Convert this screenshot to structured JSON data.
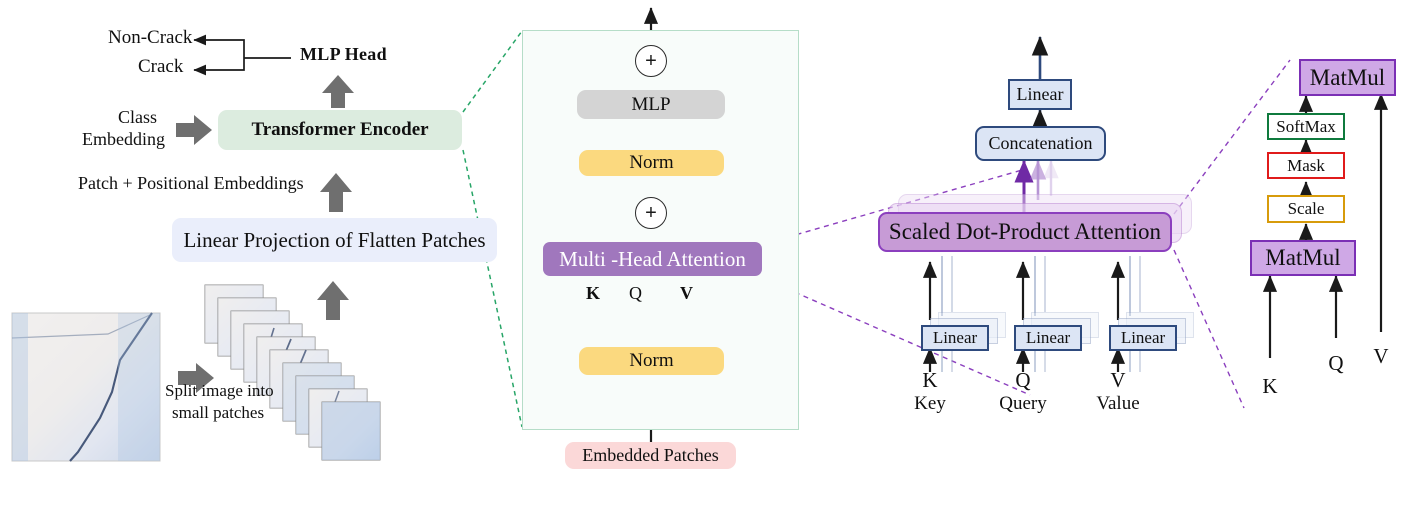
{
  "figure": {
    "title": "Vision Transformer architecture for crack classification",
    "colors": {
      "encoder_fill": "#dcecdf",
      "projection_fill": "#eaeefb",
      "norm_fill": "#fbd97f",
      "mlp_fill": "#d4d4d4",
      "mha_fill": "#a077bd",
      "embedded_fill": "#fbd8d8",
      "sdpa_fill": "#c79bd6",
      "linear_fill": "#dce5f5",
      "linear_stroke": "#2e4a7d",
      "matmul_fill": "#cfa8e6",
      "matmul_stroke": "#7b2fb5",
      "softmax_stroke": "#0f7a3d",
      "mask_stroke": "#e01b1b",
      "scale_stroke": "#d79b0b",
      "arrow_gray": "#6f6f6f",
      "dashed_green": "#27a567",
      "dashed_purple": "#8b3fbe",
      "frame_green": "#b6ddc8"
    }
  },
  "panel1": {
    "name": "vit-overview",
    "outputs": {
      "non_crack": "Non-Crack",
      "crack": "Crack"
    },
    "mlp_head": "MLP Head",
    "class_embedding_line1": "Class",
    "class_embedding_line2": "Embedding",
    "transformer_encoder": "Transformer Encoder",
    "patch_positional": "Patch + Positional Embeddings",
    "linear_projection": "Linear Projection of Flatten Patches",
    "split_line1": "Split image into",
    "split_line2": "small patches"
  },
  "panel2": {
    "name": "transformer-encoder-detail",
    "mlp": "MLP",
    "norm_top": "Norm",
    "norm_bottom": "Norm",
    "multi_head_attention": "Multi -Head Attention",
    "embedded_patches": "Embedded Patches",
    "kqv": {
      "k": "K",
      "q": "Q",
      "v": "V"
    },
    "residual_symbol": "+"
  },
  "panel3": {
    "name": "multi-head-attention-detail",
    "linear_out": "Linear",
    "concatenation": "Concatenation",
    "scaled_dot_product_attention": "Scaled Dot-Product Attention",
    "heads": [
      {
        "box": "Linear",
        "symbol": "K",
        "word": "Key"
      },
      {
        "box": "Linear",
        "symbol": "Q",
        "word": "Query"
      },
      {
        "box": "Linear",
        "symbol": "V",
        "word": "Value"
      }
    ]
  },
  "panel4": {
    "name": "scaled-dot-product-attention-detail",
    "matmul_top": "MatMul",
    "softmax": "SoftMax",
    "mask": "Mask",
    "scale": "Scale",
    "matmul_bottom": "MatMul",
    "inputs": {
      "k": "K",
      "q": "Q",
      "v": "V"
    }
  }
}
